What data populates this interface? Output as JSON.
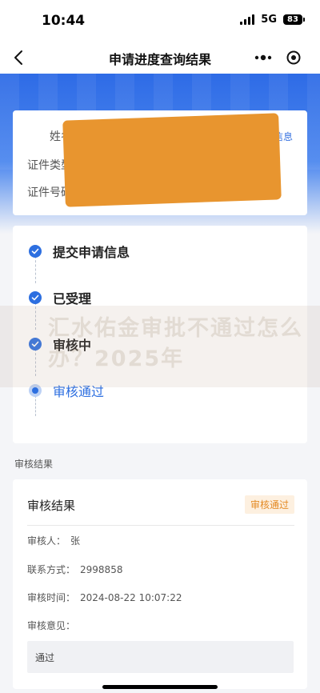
{
  "status_bar": {
    "time": "10:44",
    "network": "5G",
    "battery": "83"
  },
  "nav": {
    "title": "申请进度查询结果",
    "back_icon": "chevron-left-icon",
    "more_icon": "more-dots-icon",
    "close_icon": "target-close-icon"
  },
  "info": {
    "name_label": "姓名",
    "id_type_label": "证件类型",
    "id_no_label": "证件号码",
    "view_link": "查看申请信息",
    "redaction_color": "#e8952f"
  },
  "progress": {
    "steps": [
      {
        "label": "提交申请信息",
        "state": "done"
      },
      {
        "label": "已受理",
        "state": "done"
      },
      {
        "label": "审核中",
        "state": "done"
      },
      {
        "label": "审核通过",
        "state": "current"
      }
    ]
  },
  "watermark": {
    "text": "汇水佑金审批不通过怎么办？2025年"
  },
  "result_section": {
    "title": "审核结果"
  },
  "result": {
    "heading": "审核结果",
    "badge": "审核通过",
    "reviewer_label": "审核人：",
    "reviewer_value": "张",
    "contact_label": "联系方式：",
    "contact_value": "2998858",
    "time_label": "审核时间：",
    "time_value": "2024-08-22 10:07:22",
    "opinion_label": "审核意见：",
    "opinion_value": "通过"
  },
  "colors": {
    "primary": "#2d6fe0",
    "badge_text": "#e48a24",
    "badge_bg": "#fdf0e0"
  }
}
